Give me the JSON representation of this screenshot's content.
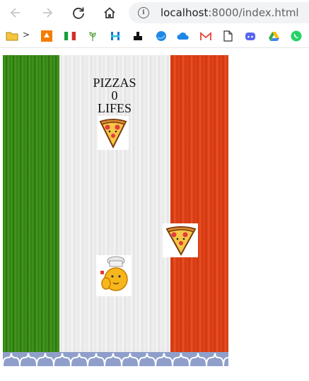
{
  "browser": {
    "url_host": "localhost",
    "url_rest": ":8000/index.html",
    "bookmarks_overflow": ">"
  },
  "icons": {
    "back": "arrow-left-icon",
    "forward": "arrow-right-icon",
    "reload": "reload-icon",
    "home": "home-icon",
    "info": "info-icon"
  },
  "game": {
    "title_label": "PIZZAS",
    "score": "0",
    "lives_label": "LIFES"
  },
  "colors": {
    "green": "#3a8f18",
    "white": "#eeeeee",
    "red": "#e0441b",
    "floor": "#8f9fca"
  }
}
